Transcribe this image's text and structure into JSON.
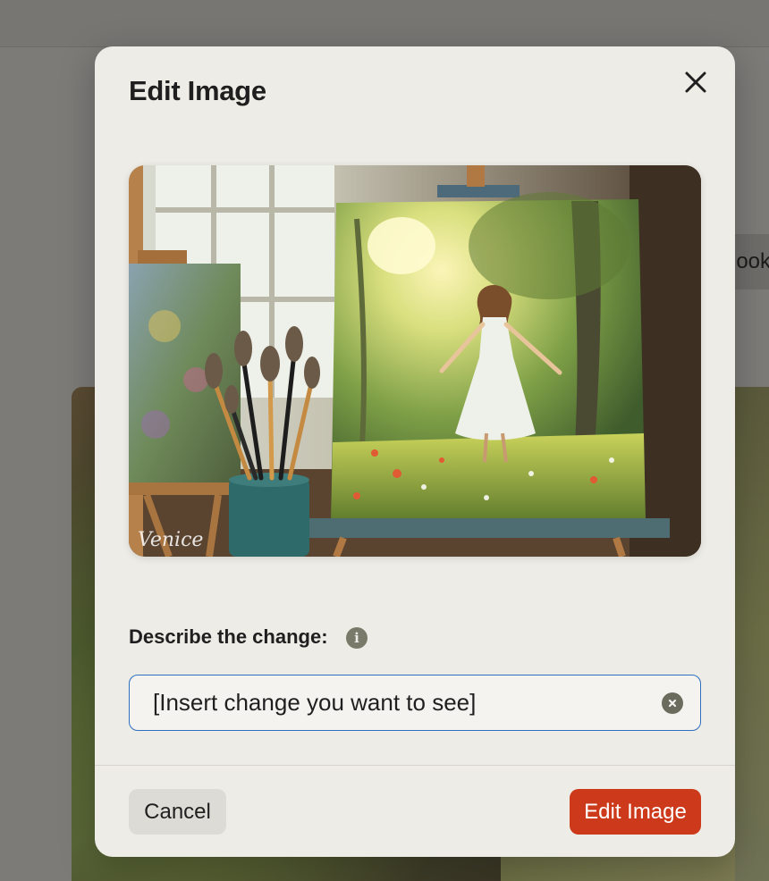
{
  "background": {
    "pill_text": "look"
  },
  "modal": {
    "title": "Edit Image",
    "preview": {
      "watermark": "Venice"
    },
    "field_label": "Describe the change:",
    "input": {
      "value": "[Insert change you want to see]"
    },
    "footer": {
      "cancel_label": "Cancel",
      "submit_label": "Edit Image"
    }
  },
  "icons": {
    "close": "close-icon",
    "info": "info-icon",
    "clear": "clear-input-icon"
  },
  "colors": {
    "accent": "#cd3a1b",
    "input_border": "#2f6fbf",
    "modal_bg": "#eeece6"
  }
}
